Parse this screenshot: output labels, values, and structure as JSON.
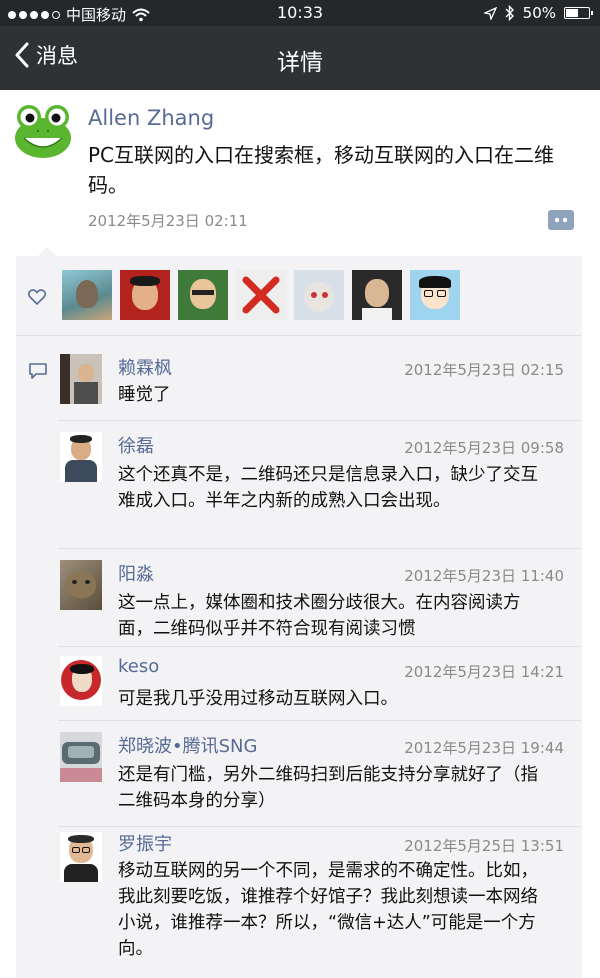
{
  "status_bar": {
    "carrier": "中国移动",
    "time": "10:33",
    "battery": "50%"
  },
  "nav": {
    "back_label": "消息",
    "title": "详情"
  },
  "post": {
    "author": "Allen Zhang",
    "text": "PC互联网的入口在搜索框，移动互联网的入口在二维码。",
    "time": "2012年5月23日 02:11",
    "avatar_icon": "frog-avatar-icon"
  },
  "likes": {
    "icon": "heart-icon",
    "avatars": [
      "liker-avatar-1",
      "liker-avatar-2",
      "liker-avatar-3",
      "liker-avatar-4",
      "liker-avatar-5",
      "liker-avatar-6",
      "liker-avatar-7"
    ]
  },
  "comments": [
    {
      "name": "赖霖枫",
      "time": "2012年5月23日 02:15",
      "text": "睡觉了"
    },
    {
      "name": "徐磊",
      "time": "2012年5月23日 09:58",
      "text": "这个还真不是，二维码还只是信息录入口，缺少了交互难成入口。半年之内新的成熟入口会出现。"
    },
    {
      "name": "阳淼",
      "time": "2012年5月23日 11:40",
      "text": "这一点上，媒体圈和技术圈分歧很大。在内容阅读方面，二维码似乎并不符合现有阅读习惯"
    },
    {
      "name": "keso",
      "time": "2012年5月23日 14:21",
      "text": "可是我几乎没用过移动互联网入口。"
    },
    {
      "name": "郑晓波•腾讯SNG",
      "time": "2012年5月23日 19:44",
      "text": "还是有门槛，另外二维码扫到后能支持分享就好了（指二维码本身的分享）"
    },
    {
      "name": "罗振宇",
      "time": "2012年5月25日 13:51",
      "text": "移动互联网的另一个不同，是需求的不确定性。比如，我此刻要吃饭，谁推荐个好馆子？我此刻想读一本网络小说，谁推荐一本？所以，“微信+达人”可能是一个方向。"
    }
  ],
  "colors": {
    "nav_bg": "#2e3235",
    "name_blue": "#576b95",
    "panel_bg": "#f3f3f5"
  }
}
